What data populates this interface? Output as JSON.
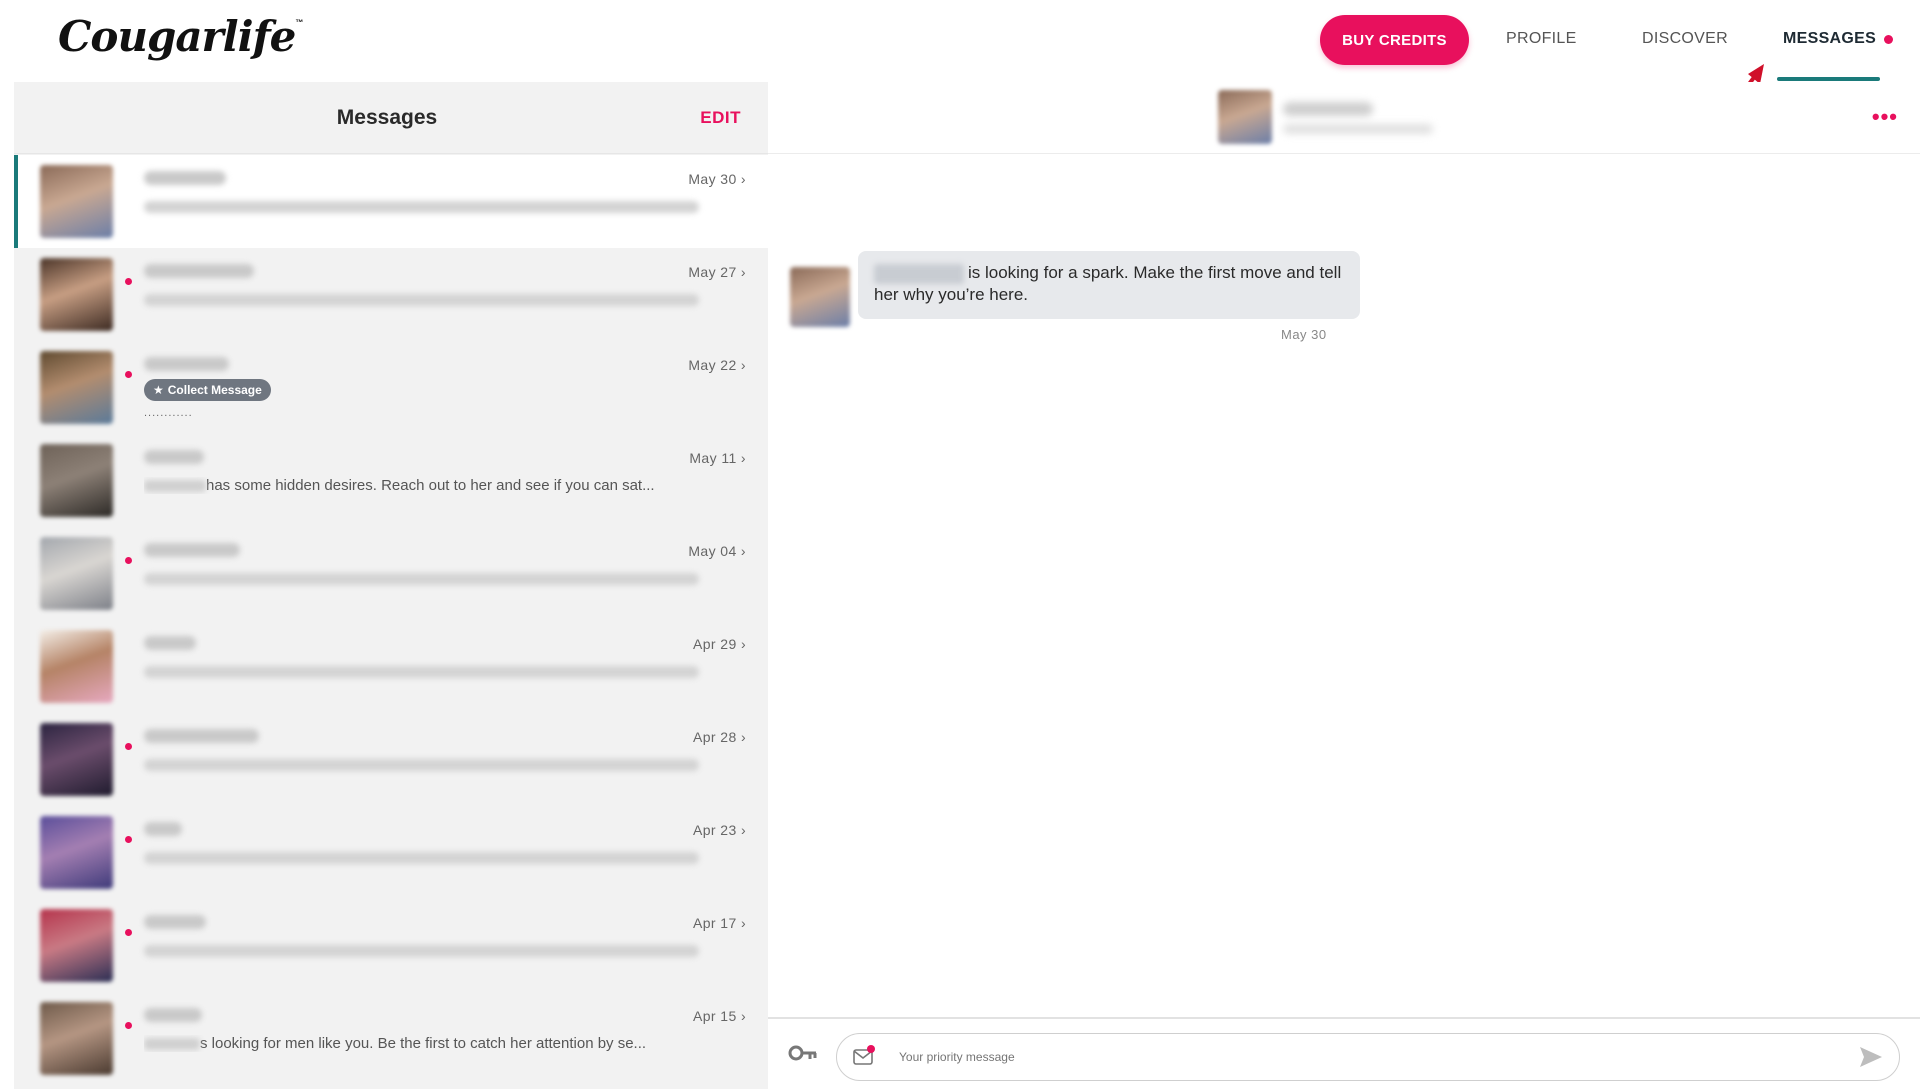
{
  "header": {
    "logo": "Cougarlife",
    "logo_tm": "™",
    "buy_credits": "BUY CREDITS",
    "nav_profile": "PROFILE",
    "nav_discover": "DISCOVER",
    "nav_messages": "MESSAGES"
  },
  "inbox": {
    "title": "Messages",
    "edit": "EDIT",
    "conversations": [
      {
        "date": "May 30 ›",
        "unread": false,
        "active": true,
        "preview": ""
      },
      {
        "date": "May 27 ›",
        "unread": true,
        "active": false,
        "preview": ""
      },
      {
        "date": "May 22 ›",
        "unread": true,
        "active": false,
        "badge": "Collect Message",
        "dots": "............"
      },
      {
        "date": "May 11 ›",
        "unread": false,
        "active": false,
        "preview": "has some hidden desires. Reach out to her and see if you can sat..."
      },
      {
        "date": "May 04 ›",
        "unread": true,
        "active": false,
        "preview": ""
      },
      {
        "date": "Apr 29 ›",
        "unread": false,
        "active": false,
        "preview": ""
      },
      {
        "date": "Apr 28 ›",
        "unread": true,
        "active": false,
        "preview": ""
      },
      {
        "date": "Apr 23 ›",
        "unread": true,
        "active": false,
        "preview": ""
      },
      {
        "date": "Apr 17 ›",
        "unread": true,
        "active": false,
        "preview": ""
      },
      {
        "date": "Apr 15 ›",
        "unread": true,
        "active": false,
        "preview": "s looking for men like you. Be the first to catch her attention by se..."
      }
    ]
  },
  "chat": {
    "more": "•••",
    "message_text": "is looking for a spark. Make the first move and tell her why you’re here.",
    "message_date": "May 30",
    "input_placeholder": "Your priority message"
  },
  "colors": {
    "accent": "#e8105d",
    "teal": "#1a7a7a"
  }
}
